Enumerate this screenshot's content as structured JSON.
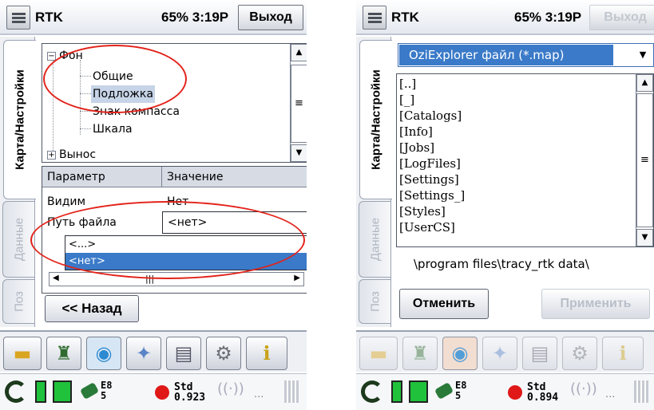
{
  "left": {
    "app": "RTK",
    "status": "65% 3:19P",
    "exit_label": "Выход",
    "tabs": [
      "Карта/Настройки",
      "Данные",
      "Поз"
    ],
    "tree": {
      "root": "Фон",
      "children": [
        "Общие",
        "Подложка",
        "Знак компасса",
        "Шкала"
      ],
      "next": "Вынос",
      "selected": "Подложка"
    },
    "grid": {
      "col_param": "Параметр",
      "col_value": "Значение",
      "rows": [
        {
          "param": "Видим",
          "value": "Нет"
        },
        {
          "param": "Путь файла",
          "value": "<нет>"
        }
      ],
      "options": [
        "<...>",
        "<нет>"
      ]
    },
    "back_label": "<< Назад",
    "std": "Std",
    "std_value": "0.923",
    "sat_e": "E",
    "sat_top": "8",
    "sat_bottom": "5",
    "ellipsis": "..."
  },
  "right": {
    "app": "RTK",
    "status": "65% 3:19P",
    "exit_label": "Выход",
    "tabs": [
      "Карта/Настройки",
      "Данные",
      "Поз"
    ],
    "filter": "OziExplorer файл (*.map)",
    "files": [
      "[..]",
      "[_]",
      "[Catalogs]",
      "[Info]",
      "[Jobs]",
      "[LogFiles]",
      "[Settings]",
      "[Settings_]",
      "[Styles]",
      "[UserCS]"
    ],
    "path": "\\program files\\tracy_rtk data\\",
    "cancel_label": "Отменить",
    "apply_label": "Применить",
    "std": "Std",
    "std_value": "0.894",
    "sat_e": "E",
    "sat_top": "8",
    "sat_bottom": "5",
    "ellipsis": "..."
  },
  "colors": {
    "highlight": "#3a7ac8",
    "annotation": "#e2231a",
    "selection": "#c7d4e8"
  }
}
